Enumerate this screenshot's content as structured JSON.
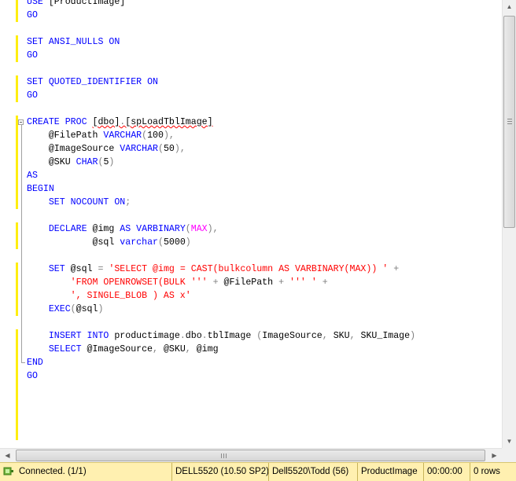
{
  "editor": {
    "lines": [
      [
        {
          "t": "USE ",
          "c": "k"
        },
        {
          "t": "[ProductImage]",
          "c": "t"
        }
      ],
      [
        {
          "t": "GO",
          "c": "k"
        }
      ],
      [],
      [
        {
          "t": "SET ",
          "c": "k"
        },
        {
          "t": "ANSI_NULLS ",
          "c": "k"
        },
        {
          "t": "ON",
          "c": "k"
        }
      ],
      [
        {
          "t": "GO",
          "c": "k"
        }
      ],
      [],
      [
        {
          "t": "SET ",
          "c": "k"
        },
        {
          "t": "QUOTED_IDENTIFIER ",
          "c": "k"
        },
        {
          "t": "ON",
          "c": "k"
        }
      ],
      [
        {
          "t": "GO",
          "c": "k"
        }
      ],
      [],
      [
        {
          "t": "CREATE ",
          "c": "k"
        },
        {
          "t": "PROC ",
          "c": "k"
        },
        {
          "t": "[dbo]",
          "c": "t",
          "sq": true
        },
        {
          "t": ".",
          "c": "p",
          "sq": true
        },
        {
          "t": "[spLoadTblImage]",
          "c": "t",
          "sq": true
        }
      ],
      [
        {
          "t": "    @FilePath ",
          "c": "t"
        },
        {
          "t": "VARCHAR",
          "c": "k"
        },
        {
          "t": "(",
          "c": "p"
        },
        {
          "t": "100",
          "c": "t"
        },
        {
          "t": "),",
          "c": "p"
        }
      ],
      [
        {
          "t": "    @ImageSource ",
          "c": "t"
        },
        {
          "t": "VARCHAR",
          "c": "k"
        },
        {
          "t": "(",
          "c": "p"
        },
        {
          "t": "50",
          "c": "t"
        },
        {
          "t": "),",
          "c": "p"
        }
      ],
      [
        {
          "t": "    @SKU ",
          "c": "t"
        },
        {
          "t": "CHAR",
          "c": "k"
        },
        {
          "t": "(",
          "c": "p"
        },
        {
          "t": "5",
          "c": "t"
        },
        {
          "t": ")",
          "c": "p"
        }
      ],
      [
        {
          "t": "AS",
          "c": "k"
        }
      ],
      [
        {
          "t": "BEGIN",
          "c": "k"
        }
      ],
      [
        {
          "t": "    SET ",
          "c": "k"
        },
        {
          "t": "NOCOUNT ",
          "c": "k"
        },
        {
          "t": "ON",
          "c": "k"
        },
        {
          "t": ";",
          "c": "p"
        }
      ],
      [],
      [
        {
          "t": "    DECLARE ",
          "c": "k"
        },
        {
          "t": "@img ",
          "c": "t"
        },
        {
          "t": "AS ",
          "c": "k"
        },
        {
          "t": "VARBINARY",
          "c": "k"
        },
        {
          "t": "(",
          "c": "p"
        },
        {
          "t": "MAX",
          "c": "f"
        },
        {
          "t": "),",
          "c": "p"
        }
      ],
      [
        {
          "t": "            @sql ",
          "c": "t"
        },
        {
          "t": "varchar",
          "c": "k"
        },
        {
          "t": "(",
          "c": "p"
        },
        {
          "t": "5000",
          "c": "t"
        },
        {
          "t": ")",
          "c": "p"
        }
      ],
      [],
      [
        {
          "t": "    SET ",
          "c": "k"
        },
        {
          "t": "@sql ",
          "c": "t"
        },
        {
          "t": "= ",
          "c": "p"
        },
        {
          "t": "'SELECT @img = CAST(bulkcolumn AS VARBINARY(MAX)) ' ",
          "c": "s"
        },
        {
          "t": "+",
          "c": "p"
        }
      ],
      [
        {
          "t": "        'FROM OPENROWSET(BULK ''' ",
          "c": "s"
        },
        {
          "t": "+ ",
          "c": "p"
        },
        {
          "t": "@FilePath ",
          "c": "t"
        },
        {
          "t": "+ ",
          "c": "p"
        },
        {
          "t": "''' ' ",
          "c": "s"
        },
        {
          "t": "+",
          "c": "p"
        }
      ],
      [
        {
          "t": "        ', SINGLE_BLOB ) AS x'",
          "c": "s"
        }
      ],
      [
        {
          "t": "    EXEC",
          "c": "k"
        },
        {
          "t": "(",
          "c": "p"
        },
        {
          "t": "@sql",
          "c": "t"
        },
        {
          "t": ")",
          "c": "p"
        }
      ],
      [],
      [
        {
          "t": "    INSERT ",
          "c": "k"
        },
        {
          "t": "INTO ",
          "c": "k"
        },
        {
          "t": "productimage",
          "c": "t"
        },
        {
          "t": ".",
          "c": "p"
        },
        {
          "t": "dbo",
          "c": "t"
        },
        {
          "t": ".",
          "c": "p"
        },
        {
          "t": "tblImage ",
          "c": "t"
        },
        {
          "t": "(",
          "c": "p"
        },
        {
          "t": "ImageSource",
          "c": "t"
        },
        {
          "t": ", ",
          "c": "p"
        },
        {
          "t": "SKU",
          "c": "t"
        },
        {
          "t": ", ",
          "c": "p"
        },
        {
          "t": "SKU_Image",
          "c": "t"
        },
        {
          "t": ")",
          "c": "p"
        }
      ],
      [
        {
          "t": "    SELECT ",
          "c": "k"
        },
        {
          "t": "@ImageSource",
          "c": "t"
        },
        {
          "t": ", ",
          "c": "p"
        },
        {
          "t": "@SKU",
          "c": "t"
        },
        {
          "t": ", ",
          "c": "p"
        },
        {
          "t": "@img",
          "c": "t"
        }
      ],
      [
        {
          "t": "END",
          "c": "k"
        }
      ],
      [
        {
          "t": "GO",
          "c": "k"
        }
      ]
    ]
  },
  "statusbar": {
    "connection": "Connected. (1/1)",
    "server": "DELL5520 (10.50 SP2)",
    "user": "Dell5520\\Todd (56)",
    "database": "ProductImage",
    "elapsed": "00:00:00",
    "rows": "0 rows"
  },
  "colors": {
    "keyword": "#0000ff",
    "string": "#ff0000",
    "function": "#ff00ff",
    "operator": "#808080",
    "changed_line_marker": "#ffee10",
    "statusbar_bg": "#fff0b0"
  },
  "icons": {
    "connection": "connected-plug-icon",
    "scroll_up": "arrow-up-icon",
    "scroll_down": "arrow-down-icon",
    "scroll_left": "arrow-left-icon",
    "scroll_right": "arrow-right-icon"
  }
}
